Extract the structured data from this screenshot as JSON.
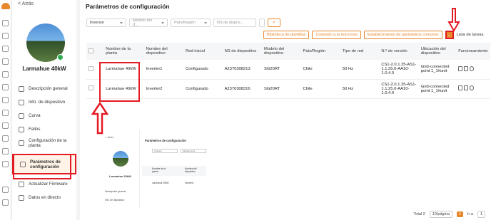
{
  "sidebar": {
    "back_label": "< Atrás",
    "plant_name": "Larmahue 40kW",
    "items": [
      {
        "label": "Descripción general",
        "icon": "overview-icon"
      },
      {
        "label": "Info. de dispositivo",
        "icon": "device-info-icon"
      },
      {
        "label": "Curva",
        "icon": "curve-icon"
      },
      {
        "label": "Fallos",
        "icon": "warning-icon"
      },
      {
        "label": "Configuración de la planta",
        "icon": "plant-config-icon"
      },
      {
        "label": "Parámetros de configuración",
        "icon": "parameters-icon"
      },
      {
        "label": "Actualizar Firmware",
        "icon": "firmware-icon"
      },
      {
        "label": "Datos en directo",
        "icon": "live-data-icon"
      }
    ]
  },
  "main": {
    "title": "Parámetros de configuración",
    "filters": {
      "device_type": "Inversor",
      "model_placeholder": "Modelo del d...",
      "country_placeholder": "País/Región",
      "sn_placeholder": "NS de dispos..."
    },
    "actions": {
      "library": "Biblioteca de plantillas",
      "grid_connection": "Conexión a la red inicial",
      "common_params": "Establecimiento de parámetros comunes",
      "task_list": "Lista de tareas"
    },
    "table": {
      "headers": [
        "Nombre de la planta",
        "Nombre del dispositivo",
        "Red inicial",
        "NS de dispositivo",
        "Modelo del dispositivo",
        "País/Región",
        "Tipo de red",
        "N.º de versión",
        "Ubicación del dispositivo",
        "Funcionamiento"
      ],
      "rows": [
        [
          "Larmahue 40kW",
          "Inverter1",
          "Configurado",
          "A2370308213",
          "SG20RT",
          "Chile",
          "50 Hz",
          "CS1-2.0.1.35-AS1-1.1.25.0-AA10-1.0.4.0",
          "Grid-connected point 1_1#unit"
        ],
        [
          "Larmahue 40kW",
          "Inverter2",
          "Configurado",
          "A2370308316",
          "SG20RT",
          "Chile",
          "50 Hz",
          "CS1-2.0.1.35-AS1-1.1.25.0-AA10-1.0.4.0",
          "Grid-connected point 1_1#unit"
        ]
      ]
    },
    "pager": {
      "total": "Total 2",
      "page_size": "10/página",
      "current": "1",
      "goto": "Ir a",
      "goto_value": "1"
    }
  },
  "inset": {
    "back": "< Atrás",
    "title": "Parámetros de configuración",
    "device_type": "Inversor",
    "model_placeholder": "Modelo del d...",
    "plant_name": "Larmahue 20kW",
    "menu": [
      "Descripción general",
      "Info. de dispositivo"
    ],
    "header_plant": "Nombre de la planta",
    "header_device": "Nombre del dispositivo",
    "row_plant": "Larmahue 20kW",
    "row_device": "Inverter1"
  },
  "colors": {
    "accent": "#e8862a",
    "highlight": "#e31b23"
  }
}
